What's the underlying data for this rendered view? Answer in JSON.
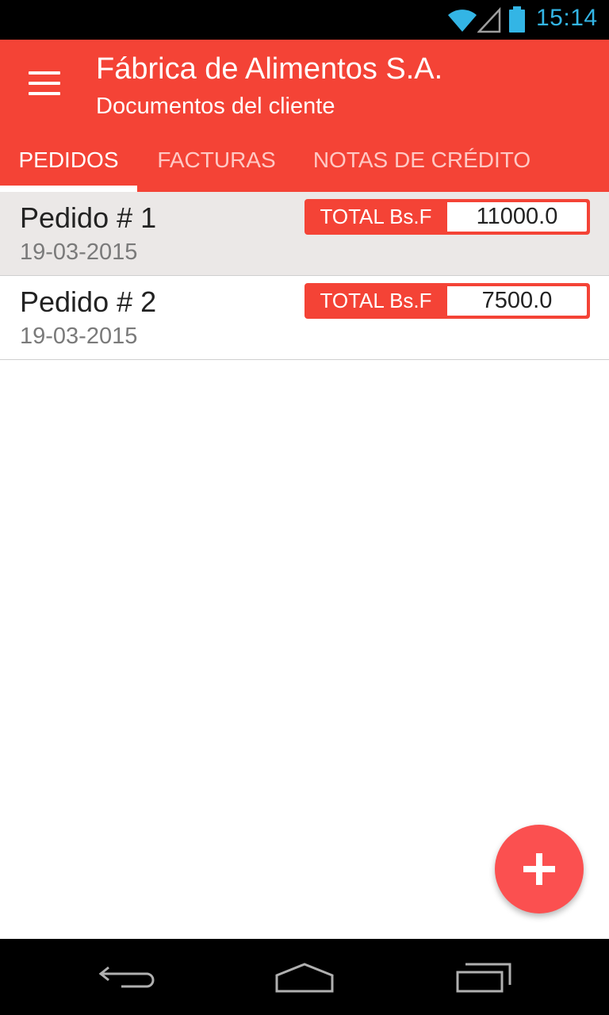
{
  "status_bar": {
    "time": "15:14",
    "icons": [
      "wifi-icon",
      "signal-icon",
      "battery-icon"
    ],
    "accent_color": "#33b5e5"
  },
  "app_bar": {
    "title": "Fábrica de Alimentos S.A.",
    "subtitle": "Documentos del cliente",
    "menu_icon": "menu-icon",
    "color": "#f44336"
  },
  "tabs": [
    {
      "label": "PEDIDOS",
      "active": true
    },
    {
      "label": "FACTURAS",
      "active": false
    },
    {
      "label": "NOTAS DE CRÉDITO",
      "active": false
    }
  ],
  "orders": [
    {
      "title": "Pedido # 1",
      "date": "19-03-2015",
      "total_label": "TOTAL Bs.F",
      "total_value": "11000.0",
      "selected": true
    },
    {
      "title": "Pedido # 2",
      "date": "19-03-2015",
      "total_label": "TOTAL Bs.F",
      "total_value": "7500.0",
      "selected": false
    }
  ],
  "fab": {
    "icon": "plus-icon",
    "color": "#fb5050"
  },
  "nav_bar": {
    "icons": [
      "back-icon",
      "home-icon",
      "recent-apps-icon"
    ]
  }
}
